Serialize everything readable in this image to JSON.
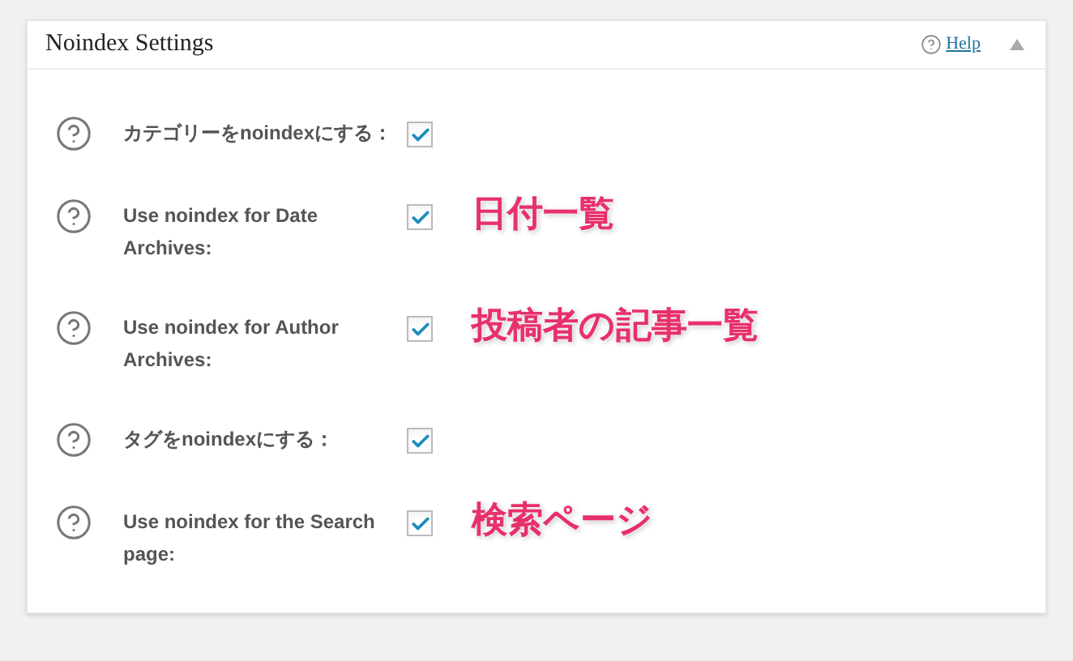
{
  "panel": {
    "title": "Noindex Settings",
    "help_link": "Help",
    "expanded": true
  },
  "settings": [
    {
      "label": "カテゴリーをnoindexにする：",
      "checked": true
    },
    {
      "label": "Use noindex for Date Archives:",
      "checked": true,
      "note": "日付一覧"
    },
    {
      "label": "Use noindex for Author Archives:",
      "checked": true,
      "note": "投稿者の記事一覧"
    },
    {
      "label": "タグをnoindexにする：",
      "checked": true
    },
    {
      "label": "Use noindex for the Search page:",
      "checked": true,
      "note": "検索ページ"
    }
  ]
}
